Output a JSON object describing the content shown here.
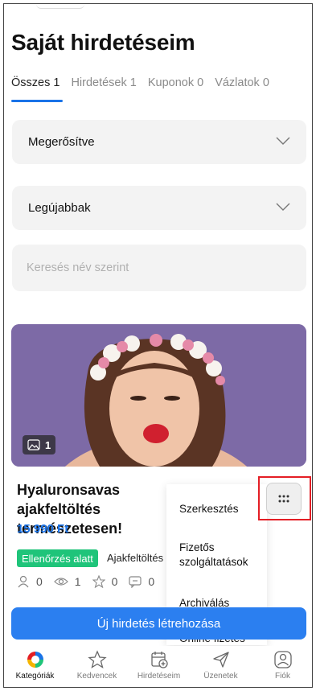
{
  "page_title": "Saját hirdetéseim",
  "tabs": [
    {
      "label": "Összes 1"
    },
    {
      "label": "Hirdetések 1"
    },
    {
      "label": "Kuponok 0"
    },
    {
      "label": "Vázlatok 0"
    }
  ],
  "filters": {
    "status_value": "Megerősítve",
    "sort_value": "Legújabbak"
  },
  "search": {
    "placeholder": "Keresés név szerint"
  },
  "ad": {
    "photo_count": "1",
    "title": "Hyaluronsavas ajakfeltöltés természetesen!",
    "price": "15 990 Ft",
    "status": "Ellenőrzés alatt",
    "category": "Ajakfeltöltés",
    "stats": {
      "users": "0",
      "views": "1",
      "favorites": "0",
      "messages": "0"
    }
  },
  "menu": {
    "items": [
      "Szerkesztés",
      "Fizetős szolgáltatások",
      "Archiválás",
      "Online fizetés"
    ]
  },
  "cta_label": "Új hirdetés létrehozása",
  "bottom_nav": [
    {
      "label": "Kategóriák",
      "icon": "categories-logo-icon"
    },
    {
      "label": "Kedvencek",
      "icon": "star-icon"
    },
    {
      "label": "Hirdetéseim",
      "icon": "calendar-plus-icon"
    },
    {
      "label": "Üzenetek",
      "icon": "send-icon"
    },
    {
      "label": "Fiók",
      "icon": "account-icon"
    }
  ],
  "colors": {
    "accent": "#1a73e8",
    "status_green": "#1fc47a",
    "highlight_red": "#e41e25",
    "image_bg": "#7d6aa6"
  }
}
